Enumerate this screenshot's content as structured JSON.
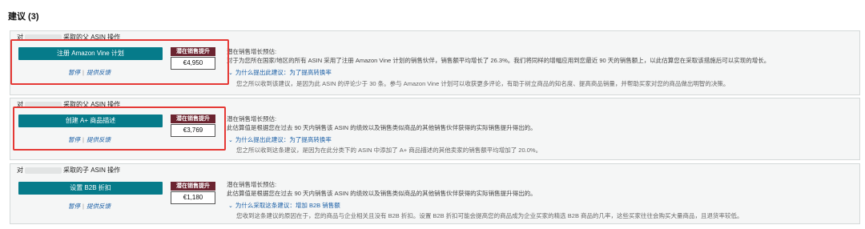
{
  "section_title": "建议 (3)",
  "cards": [
    {
      "head_prefix": "对",
      "head_suffix": "采取的父 ASIN 操作",
      "action_label": "注册 Amazon Vine 计划",
      "dismiss_label": "暂停",
      "feedback_label": "提供反馈",
      "badge_label": "潜在销售提升",
      "amount": "€4,950",
      "desc_line1": "潜在销售增长预估:",
      "desc_line2": "对于为您所在国家/地区的所有 ASIN 采用了注册 Amazon Vine 计划的销售伙伴，销售额平均增长了 26.3%。我们将同样的增幅应用到您最近 90 天的销售额上，以此估算您在采取该措施后可以实现的增长。",
      "why_label": "为什么提出此建议：为了提高转换率",
      "reason": "您之所以收到该建议，是因为此 ASIN 的评论少于 30 条。参与 Amazon Vine 计划可以收获更多评论，有助于树立商品的知名度、提高商品销量，并帮助买家对您的商品做出明智的决策。"
    },
    {
      "head_prefix": "对",
      "head_suffix": "采取的父 ASIN 操作",
      "action_label": "创建 A+ 商品描述",
      "dismiss_label": "暂停",
      "feedback_label": "提供反馈",
      "badge_label": "潜在销售提升",
      "amount": "€3,769",
      "desc_line1": "潜在销售增长预估:",
      "desc_line2": "此估算值是根据您在过去 90 天内销售该 ASIN 的绩效以及销售类似商品的其他销售伙伴获得的实际销售提升得出的。",
      "why_label": "为什么提出此建议：为了提高转换率",
      "reason": "您之所以收到这条建议，是因为在此分类下的 ASIN 中添加了 A+ 商品描述的其他卖家的销售额平均增加了 20.0%。"
    },
    {
      "head_prefix": "对",
      "head_suffix": "采取的子 ASIN 操作",
      "action_label": "设置 B2B 折扣",
      "dismiss_label": "暂停",
      "feedback_label": "提供反馈",
      "badge_label": "潜在销售提升",
      "amount": "€1,180",
      "desc_line1": "潜在销售增长预估:",
      "desc_line2": "此估算值是根据您在过去 90 天内销售该 ASIN 的绩效以及销售类似商品的其他销售伙伴获得的实际销售提升得出的。",
      "why_label": "为什么采取这条建议：增加 B2B 销售额",
      "reason": "您收到这条建议的原因在于，您的商品与企业相关且没有 B2B 折扣。设置 B2B 折扣可能会提高您的商品成为企业买家的精选 B2B 商品的几率，这些买家往往会购买大量商品，且退货率较低。"
    }
  ],
  "colors": {
    "action_button": "#067b8a",
    "badge": "#6b2430",
    "highlight": "#e53935",
    "link": "#1a5fa6"
  }
}
